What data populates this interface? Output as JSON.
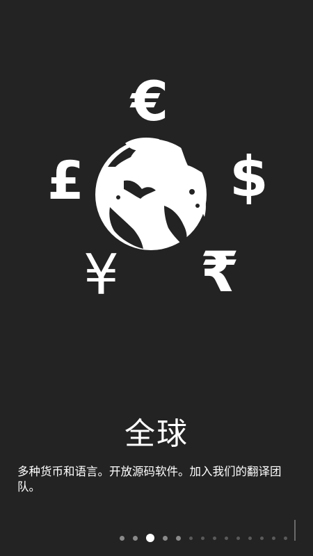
{
  "onboarding": {
    "title": "全球",
    "description": "多种货币和语言。开放源码软件。加入我们的翻译团队。"
  },
  "illustration": {
    "symbols": {
      "euro": "€",
      "pound": "£",
      "dollar": "$",
      "yen": "¥",
      "rupee": "₹"
    },
    "icon": "globe-icon"
  },
  "pager": {
    "total": 14,
    "current": 3
  },
  "colors": {
    "background": "#232323",
    "foreground": "#ffffff"
  }
}
